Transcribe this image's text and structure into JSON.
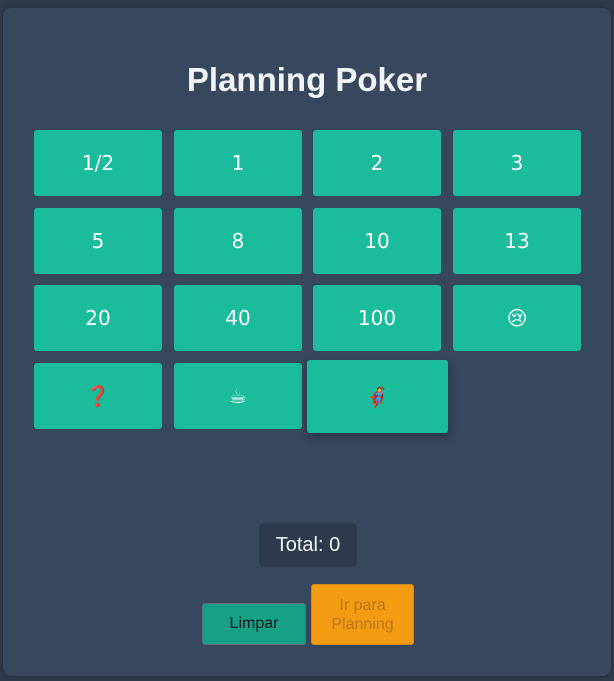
{
  "header": {
    "title": "Planning Poker"
  },
  "cards": [
    {
      "label": "1/2"
    },
    {
      "label": "1"
    },
    {
      "label": "2"
    },
    {
      "label": "3"
    },
    {
      "label": "5"
    },
    {
      "label": "8"
    },
    {
      "label": "10"
    },
    {
      "label": "13"
    },
    {
      "label": "20"
    },
    {
      "label": "40"
    },
    {
      "label": "100"
    },
    {
      "label": "😢"
    },
    {
      "label": "❓"
    },
    {
      "label": "☕"
    },
    {
      "label": "🦸"
    }
  ],
  "summary": {
    "total_label": "Total: 0"
  },
  "actions": {
    "clear_label": "Limpar",
    "go_label": "Ir para Planning"
  },
  "colors": {
    "card": "#1abc9c",
    "panel": "#37475e",
    "clear_button": "#16a085",
    "go_button": "#f39c12"
  }
}
